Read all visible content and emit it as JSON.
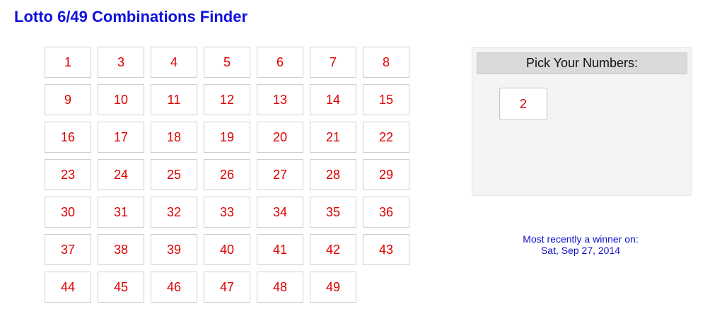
{
  "header": {
    "title": "Lotto 6/49 Combinations Finder"
  },
  "number_grid": {
    "numbers": [
      "1",
      "3",
      "4",
      "5",
      "6",
      "7",
      "8",
      "9",
      "10",
      "11",
      "12",
      "13",
      "14",
      "15",
      "16",
      "17",
      "18",
      "19",
      "20",
      "21",
      "22",
      "23",
      "24",
      "25",
      "26",
      "27",
      "28",
      "29",
      "30",
      "31",
      "32",
      "33",
      "34",
      "35",
      "36",
      "37",
      "38",
      "39",
      "40",
      "41",
      "42",
      "43",
      "44",
      "45",
      "46",
      "47",
      "48",
      "49"
    ]
  },
  "pick_panel": {
    "heading": "Pick Your Numbers:",
    "picked": [
      "2"
    ]
  },
  "winner_info": {
    "line1": "Most recently a winner on:",
    "line2": "Sat, Sep 27, 2014"
  },
  "colors": {
    "title": "#1010e0",
    "number_text": "#e00000",
    "winner_text": "#1010c8",
    "panel_background": "#f4f4f4",
    "panel_header_background": "#dadada"
  }
}
